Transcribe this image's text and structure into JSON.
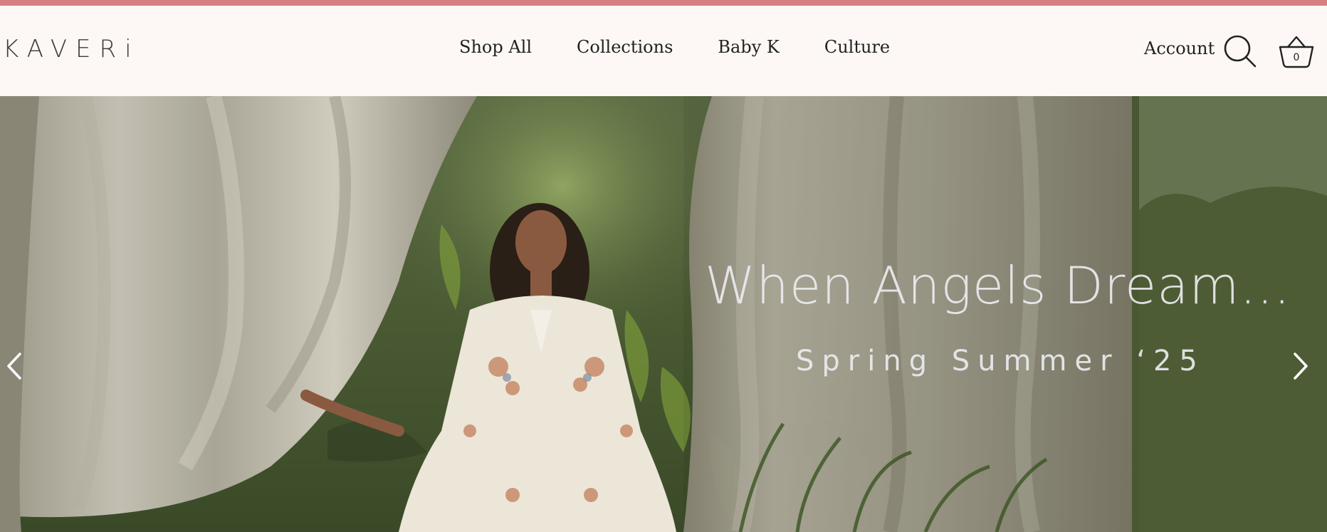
{
  "brand": {
    "logo_text": "KAVERi"
  },
  "nav": {
    "items": [
      {
        "label": "Shop All"
      },
      {
        "label": "Collections"
      },
      {
        "label": "Baby K"
      },
      {
        "label": "Culture"
      }
    ]
  },
  "header": {
    "account_label": "Account",
    "cart_count": "0"
  },
  "icons": {
    "search": "search-icon",
    "cart": "basket-icon",
    "prev": "chevron-left-icon",
    "next": "chevron-right-icon"
  },
  "hero": {
    "title": "When Angels Dream...",
    "subtitle": "Spring Summer ‘25"
  },
  "colors": {
    "top_strip": "#d57f80",
    "header_bg": "#fdf8f5",
    "nav_text": "#222222",
    "hero_text": "#ecEAEE"
  }
}
